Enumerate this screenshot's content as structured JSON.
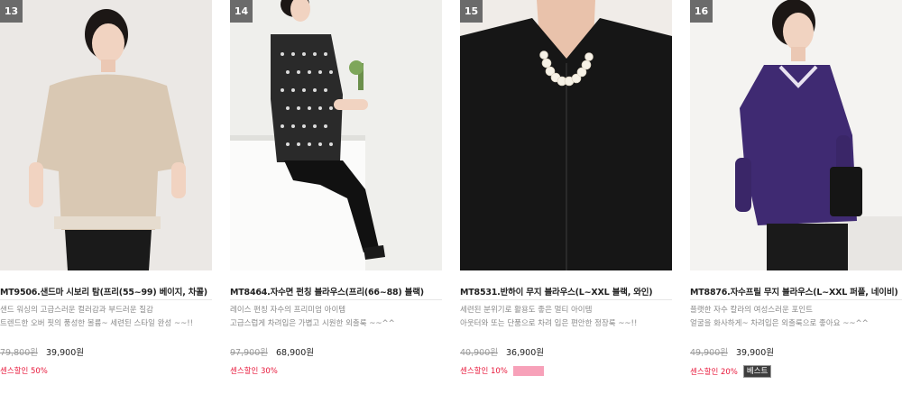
{
  "products": [
    {
      "rank": "13",
      "name": "MT9506.샌드마 시보리 탐(프리(55~99) 베이지, 차콜)",
      "desc1": "샌드 워싱의 고급스러운 컬러감과 부드러운 질감",
      "desc2": "트렌드한 오버 핏의 풍성한 볼륨~ 세련된 스타일 완성 ~~!!",
      "price_original": "79,800원",
      "price_sale": "39,900원",
      "discount": "센스할인 50%",
      "badge": ""
    },
    {
      "rank": "14",
      "name": "MT8464.자수면 펀칭 블라우스(프리(66~88) 블랙)",
      "desc1": "레이스 펀칭 자수의 프리미엄 아이템",
      "desc2": "고급스럽게 차려입은 가볍고 시원한 외출룩 ~~^^",
      "price_original": "97,900원",
      "price_sale": "68,900원",
      "discount": "센스할인 30%",
      "badge": ""
    },
    {
      "rank": "15",
      "name": "MT8531.반하이 무지 블라우스(L~XXL 블랙, 와인)",
      "desc1": "세련된 분위기로 활용도 좋은 멀티 아이템",
      "desc2": "아웃터와 또는 단품으로 차려 입은 편안한 정장룩 ~~!!",
      "price_original": "40,900원",
      "price_sale": "36,900원",
      "discount": "센스할인 10%",
      "badge": ""
    },
    {
      "rank": "16",
      "name": "MT8876.자수프릴 무지 블라우스(L~XXL 퍼플, 네이비)",
      "desc1": "플랫한 자수 칼라의 여성스러운 포인트",
      "desc2": "얼굴을 화사하게~ 차려입은 외출룩으로 좋아요 ~~^^",
      "price_original": "49,900원",
      "price_sale": "39,900원",
      "discount": "센스할인 20%",
      "badge": "베스트"
    }
  ],
  "colors": {
    "discount": "#e8173a",
    "pink_tag": "#f7a1b9",
    "rank_badge": "#6b6b6b",
    "best_badge": "#3d3d3d"
  }
}
